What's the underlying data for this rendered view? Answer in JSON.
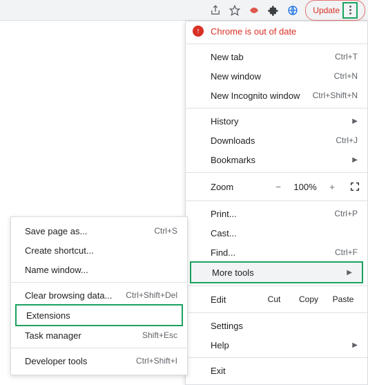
{
  "toolbar": {
    "update": "Update"
  },
  "menu": {
    "out_of_date": "Chrome is out of date",
    "new_tab": {
      "label": "New tab",
      "sc": "Ctrl+T"
    },
    "new_window": {
      "label": "New window",
      "sc": "Ctrl+N"
    },
    "new_incognito": {
      "label": "New Incognito window",
      "sc": "Ctrl+Shift+N"
    },
    "history": {
      "label": "History"
    },
    "downloads": {
      "label": "Downloads",
      "sc": "Ctrl+J"
    },
    "bookmarks": {
      "label": "Bookmarks"
    },
    "zoom": {
      "label": "Zoom",
      "value": "100%",
      "minus": "−",
      "plus": "+"
    },
    "print": {
      "label": "Print...",
      "sc": "Ctrl+P"
    },
    "cast": {
      "label": "Cast..."
    },
    "find": {
      "label": "Find...",
      "sc": "Ctrl+F"
    },
    "more_tools": {
      "label": "More tools"
    },
    "edit": {
      "label": "Edit",
      "cut": "Cut",
      "copy": "Copy",
      "paste": "Paste"
    },
    "settings": {
      "label": "Settings"
    },
    "help": {
      "label": "Help"
    },
    "exit": {
      "label": "Exit"
    }
  },
  "submenu": {
    "save_page": {
      "label": "Save page as...",
      "sc": "Ctrl+S"
    },
    "create_shortcut": {
      "label": "Create shortcut..."
    },
    "name_window": {
      "label": "Name window..."
    },
    "clear_data": {
      "label": "Clear browsing data...",
      "sc": "Ctrl+Shift+Del"
    },
    "extensions": {
      "label": "Extensions"
    },
    "task_manager": {
      "label": "Task manager",
      "sc": "Shift+Esc"
    },
    "dev_tools": {
      "label": "Developer tools",
      "sc": "Ctrl+Shift+I"
    }
  }
}
